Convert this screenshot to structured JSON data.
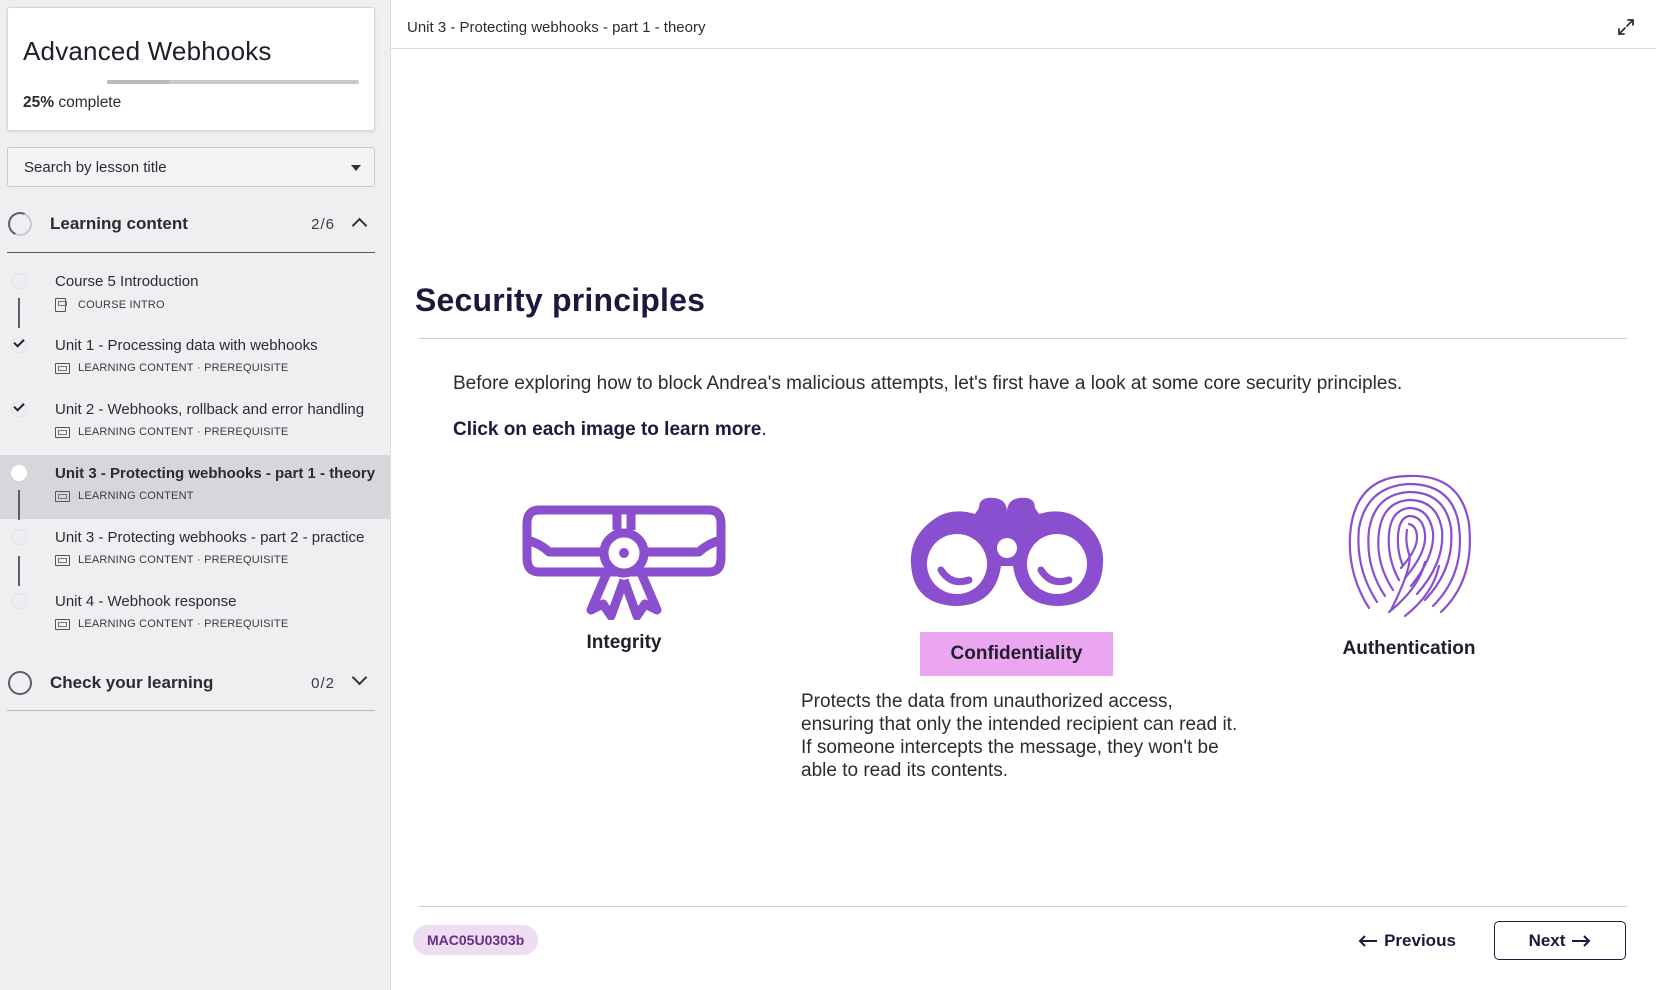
{
  "sidebar": {
    "course_title": "Advanced Webhooks",
    "progress": {
      "percent_text": "25%",
      "suffix": "complete",
      "fraction": 0.25
    },
    "search": {
      "placeholder": "Search by lesson title"
    },
    "sections": [
      {
        "title": "Learning content",
        "count": "2/6",
        "expanded": true,
        "lessons": [
          {
            "title": "Course 5 Introduction",
            "type": "COURSE INTRO",
            "tag": "",
            "completed": false,
            "active": false
          },
          {
            "title": "Unit 1 - Processing data with webhooks",
            "type": "LEARNING CONTENT",
            "tag": "PREREQUISITE",
            "completed": true,
            "active": false
          },
          {
            "title": "Unit 2 - Webhooks, rollback and error handling",
            "type": "LEARNING CONTENT",
            "tag": "PREREQUISITE",
            "completed": true,
            "active": false
          },
          {
            "title": "Unit 3 - Protecting webhooks - part 1 - theory",
            "type": "LEARNING CONTENT",
            "tag": "",
            "completed": false,
            "active": true
          },
          {
            "title": "Unit 3 - Protecting webhooks - part 2 - practice",
            "type": "LEARNING CONTENT",
            "tag": "PREREQUISITE",
            "completed": false,
            "active": false
          },
          {
            "title": "Unit 4 - Webhook response",
            "type": "LEARNING CONTENT",
            "tag": "PREREQUISITE",
            "completed": false,
            "active": false
          }
        ]
      },
      {
        "title": "Check your learning",
        "count": "0/2",
        "expanded": false
      }
    ],
    "meta_separator": "·"
  },
  "main": {
    "breadcrumb": "Unit 3 - Protecting webhooks - part 1 - theory",
    "title": "Security principles",
    "intro": "Before exploring how to block Andrea's malicious attempts, let's first have a look at some core security principles.",
    "instruction": "Click on each image to learn more",
    "instruction_end": ".",
    "principles": [
      {
        "label": "Integrity",
        "icon": "diploma-icon"
      },
      {
        "label": "Confidentiality",
        "icon": "binoculars-icon",
        "selected": true
      },
      {
        "label": "Authentication",
        "icon": "fingerprint-icon"
      }
    ],
    "description": "Protects the data from unauthorized access, ensuring that only the intended recipient can read it. If someone intercepts the message, they won't be able to read its contents.",
    "code": "MAC05U0303b",
    "prev_label": "Previous",
    "next_label": "Next",
    "colors": {
      "accent": "#8a4fcf",
      "highlight": "#eba6f2",
      "title": "#21163d",
      "badge_bg": "#eedcf3",
      "badge_text": "#6b2c86"
    }
  }
}
